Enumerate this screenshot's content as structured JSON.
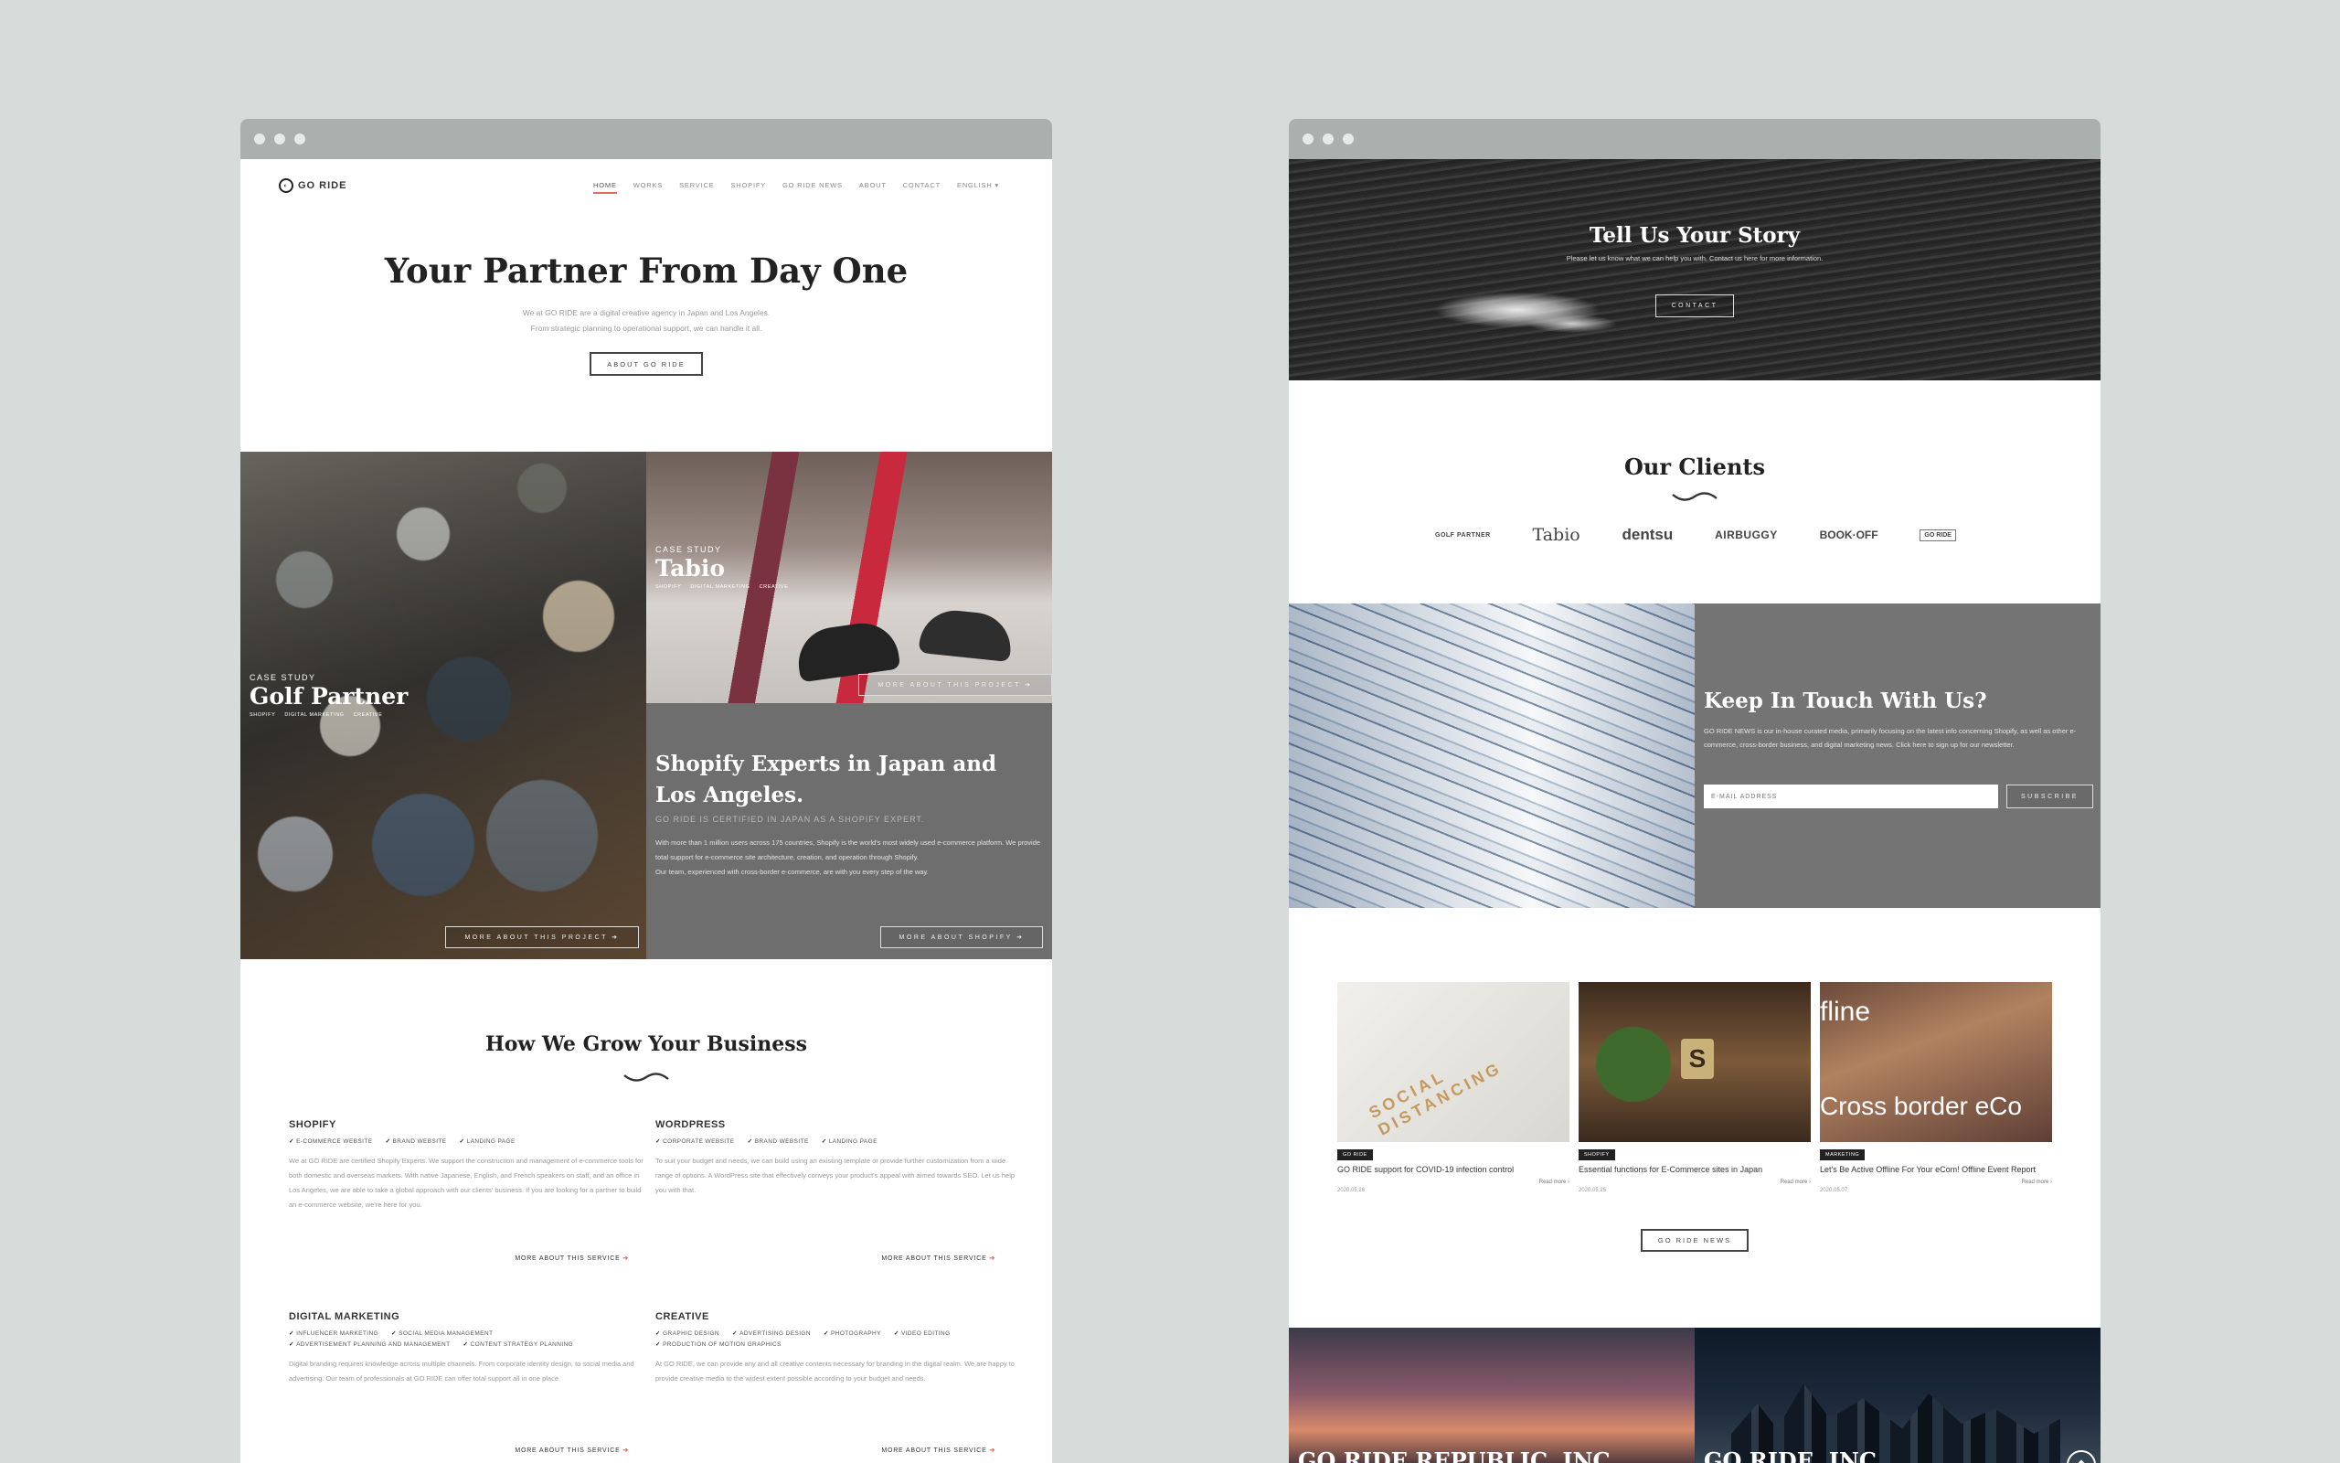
{
  "left_site": {
    "logo": "GO RIDE",
    "nav": [
      "HOME",
      "WORKS",
      "SERVICE",
      "SHOPIFY",
      "GO RIDE NEWS",
      "ABOUT",
      "CONTACT",
      "ENGLISH ▾"
    ],
    "hero": {
      "title": "Your Partner From Day One",
      "sub1": "We at GO RIDE are a digital creative agency in Japan and Los Angeles.",
      "sub2": "From strategic planning to operational support, we can handle it all.",
      "button": "ABOUT GO RIDE"
    },
    "cases": {
      "golf": {
        "kicker": "CASE STUDY",
        "name": "Golf Partner",
        "tags": [
          "SHOPIFY",
          "DIGITAL MARKETING",
          "CREATIVE"
        ],
        "button": "MORE ABOUT THIS PROJECT ➔"
      },
      "tabio": {
        "kicker": "CASE STUDY",
        "name": "Tabio",
        "tags": [
          "SHOPIFY",
          "DIGITAL MARKETING",
          "CREATIVE"
        ],
        "button": "MORE ABOUT THIS PROJECT ➔"
      }
    },
    "shopify": {
      "title": "Shopify Experts in Japan and Los Angeles.",
      "kicker": "GO RIDE IS CERTIFIED IN JAPAN AS A SHOPIFY EXPERT.",
      "body1": "With more than 1 million users across 175 countries, Shopify is the world's most widely used e-commerce platform. We provide total support for e-commerce site architecture, creation, and operation through Shopify.",
      "body2": "Our team, experienced with cross-border e-commerce, are with you every step of the way.",
      "button": "MORE ABOUT SHOPIFY ➔"
    },
    "grow_title": "How We Grow Your Business",
    "services": [
      {
        "title": "SHOPIFY",
        "checks": [
          "E-COMMERCE WEBSITE",
          "BRAND WEBSITE",
          "LANDING PAGE"
        ],
        "body": "We at GO RIDE are certified Shopify Experts. We support the construction and management of e-commerce tools for both domestic and overseas markets. With native Japanese, English, and French speakers on staff, and an office in Los Angeles, we are able to take a global approach with our clients' business. If you are looking for a partner to build an e-commerce website, we're here for you.",
        "more": "MORE ABOUT THIS SERVICE"
      },
      {
        "title": "WORDPRESS",
        "checks": [
          "CORPORATE WEBSITE",
          "BRAND WEBSITE",
          "LANDING PAGE"
        ],
        "body": "To suit your budget and needs, we can build using an existing template or provide further customization from a wide range of options. A WordPress site that effectively conveys your product's appeal with aimed towards SEO. Let us help you with that.",
        "more": "MORE ABOUT THIS SERVICE"
      },
      {
        "title": "DIGITAL MARKETING",
        "checks": [
          "INFLUENCER MARKETING",
          "SOCIAL MEDIA MANAGEMENT",
          "ADVERTISEMENT PLANNING AND MANAGEMENT",
          "CONTENT STRATEGY PLANNING"
        ],
        "body": "Digital branding requires knowledge across multiple channels. From corporate identity design, to social media and advertising. Our team of professionals at GO RIDE can offer total support all in one place.",
        "more": "MORE ABOUT THIS SERVICE"
      },
      {
        "title": "CREATIVE",
        "checks": [
          "GRAPHIC DESIGN",
          "ADVERTISING DESIGN",
          "PHOTOGRAPHY",
          "VIDEO EDITING",
          "PRODUCTION OF MOTION GRAPHICS"
        ],
        "body": "At GO RIDE, we can provide any and all creative contents necessary for branding in the digital realm. We are happy to provide creative media to the widest extent possible according to your budget and needs.",
        "more": "MORE ABOUT THIS SERVICE"
      }
    ]
  },
  "right_site": {
    "story": {
      "title": "Tell Us Your Story",
      "sub": "Please let us know what we can help you with.  Contact us here for more information.",
      "button": "CONTACT"
    },
    "clients_title": "Our Clients",
    "clients": [
      "GOLF PARTNER",
      "Tabio",
      "dentsu",
      "AIRBUGGY",
      "BOOK·OFF",
      "GO RIDE"
    ],
    "touch": {
      "title": "Keep In Touch With Us?",
      "body": "GO RIDE NEWS is our in-house curated media, primarily focusing on the latest info concerning Shopify, as well as other e-commerce, cross-border business, and digital marketing news. Click here to sign up for our newsletter.",
      "placeholder": "E-MAIL ADDRESS",
      "button": "SUBSCRIBE"
    },
    "news": [
      {
        "thumb_text": "SOCIAL DISTANCING",
        "badge": "GO RIDE",
        "title": "GO RIDE support for COVID-19 infection control",
        "date": "2020.05.26",
        "read": "Read more ›"
      },
      {
        "thumb_text": "",
        "badge": "SHOPIFY",
        "title": "Essential functions for E-Commerce sites in Japan",
        "date": "2020.05.25",
        "read": "Read more ›"
      },
      {
        "thumb_text": "fline",
        "thumb_text2": "Cross border eCo",
        "badge": "MARKETING",
        "title": "Let's Be Active Offline For Your eCom! Offline Event Report",
        "date": "2020.05.07",
        "read": "Read more ›"
      }
    ],
    "news_button": "GO RIDE NEWS",
    "offices": [
      "GO RIDE REPUBLIC, INC.",
      "GO RIDE, INC."
    ],
    "to_top": "⬆"
  }
}
